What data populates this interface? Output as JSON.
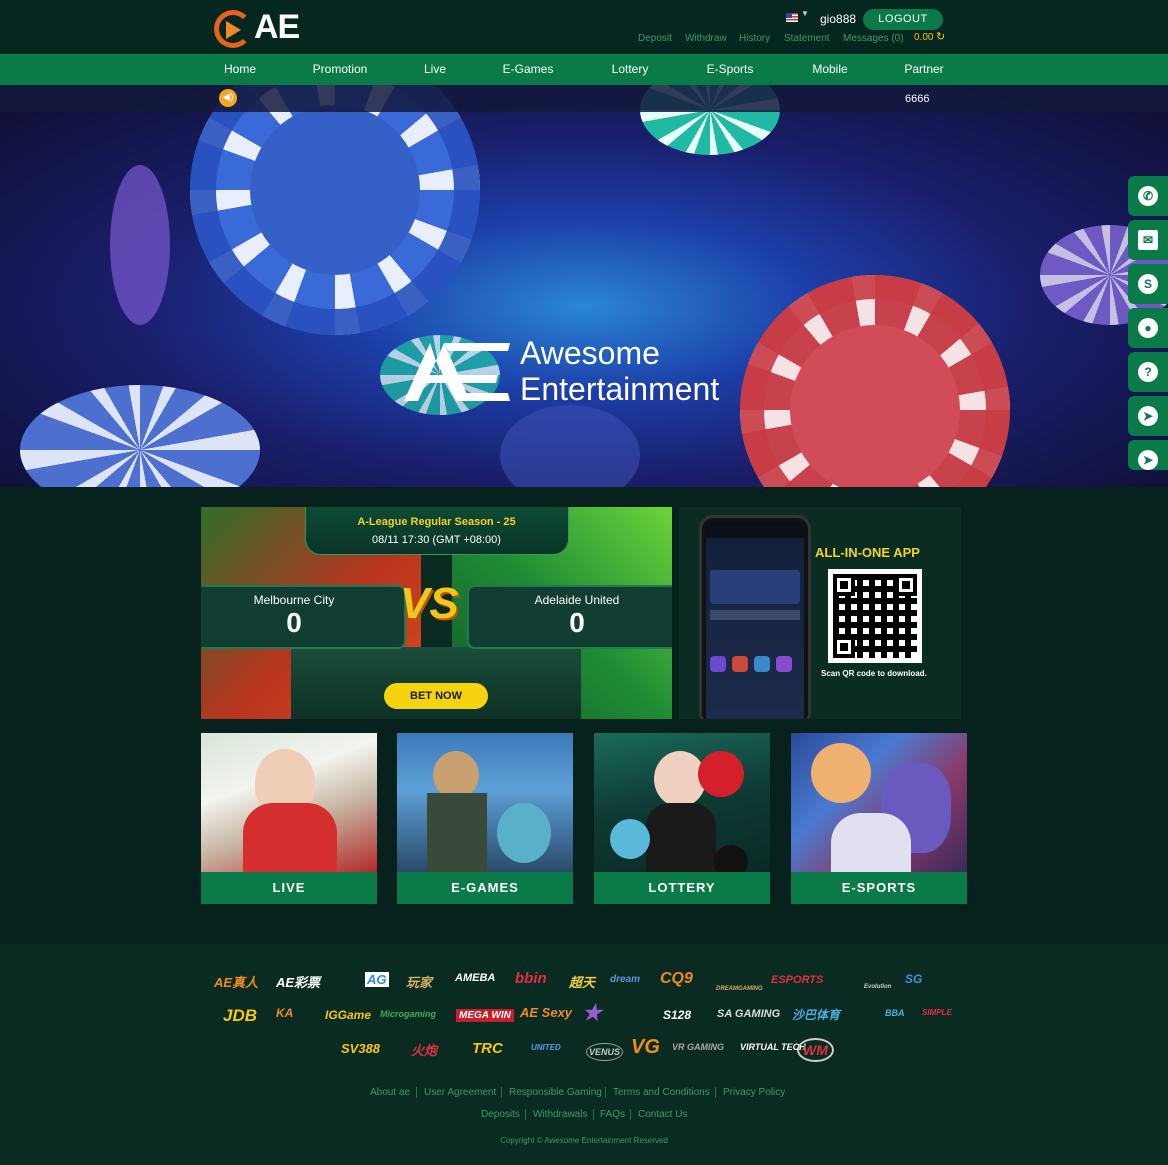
{
  "header": {
    "logo_text": "AE",
    "username": "gio888",
    "logout_label": "LOGOUT",
    "top_links": [
      "Deposit",
      "Withdraw",
      "History",
      "Statement",
      "Messages (0)"
    ],
    "balance": "0.00",
    "language_flag_icon": "us-flag-icon"
  },
  "nav": {
    "items": [
      "Home",
      "Promotion",
      "Live",
      "E-Games",
      "Lottery",
      "E-Sports",
      "Mobile",
      "Partner"
    ]
  },
  "marquee": {
    "text": "6666"
  },
  "banner": {
    "line1": "Awesome",
    "line2": "Entertainment"
  },
  "socials": [
    "whatsapp-icon",
    "mail-icon",
    "skype-icon",
    "user-icon",
    "help-icon",
    "telegram-icon",
    "telegram-icon"
  ],
  "match": {
    "league": "A-League Regular Season - 25",
    "datetime": "08/11 17:30 (GMT +08:00)",
    "home_team": "Melbourne City",
    "home_score": "0",
    "away_team": "Adelaide United",
    "away_score": "0",
    "vs": "VS",
    "bet_label": "BET NOW"
  },
  "app": {
    "title": "ALL-IN-ONE APP",
    "subtitle": "Scan QR code to download."
  },
  "categories": [
    {
      "label": "LIVE"
    },
    {
      "label": "E-GAMES"
    },
    {
      "label": "LOTTERY"
    },
    {
      "label": "E-SPORTS"
    }
  ],
  "providers": {
    "row1": [
      "AE真人",
      "AE彩票",
      "AG",
      "玩家",
      "AMEBA",
      "bbin",
      "超天",
      "dream",
      "CQ9",
      "DREAMGAMING",
      "ESPORTS",
      "Evolution",
      "SG"
    ],
    "row2": [
      "JDB",
      "KA",
      "IGGame",
      "Microgaming",
      "MEGA WIN",
      "AE Sexy",
      "★",
      "S128",
      "SA GAMING",
      "沙巴体育",
      "BBA",
      "SIMPLE"
    ],
    "row3": [
      "SV388",
      "火炮",
      "TRC",
      "UNITED",
      "VENUS",
      "VG",
      "VR GAMING",
      "VIRTUAL TECH",
      "WM"
    ]
  },
  "footer": {
    "links_row1": [
      "About ae",
      "User Agreement",
      "Responsible Gaming",
      "Terms and Conditions",
      "Privacy Policy"
    ],
    "links_row2": [
      "Deposits",
      "Withdrawals",
      "FAQs",
      "Contact Us"
    ],
    "copyright": "Copyright © Awesome Entertainment Reserved"
  },
  "colors": {
    "brand_green": "#0a7a48",
    "accent_yellow": "#f5d22a",
    "link_green": "#3f9a6d"
  }
}
